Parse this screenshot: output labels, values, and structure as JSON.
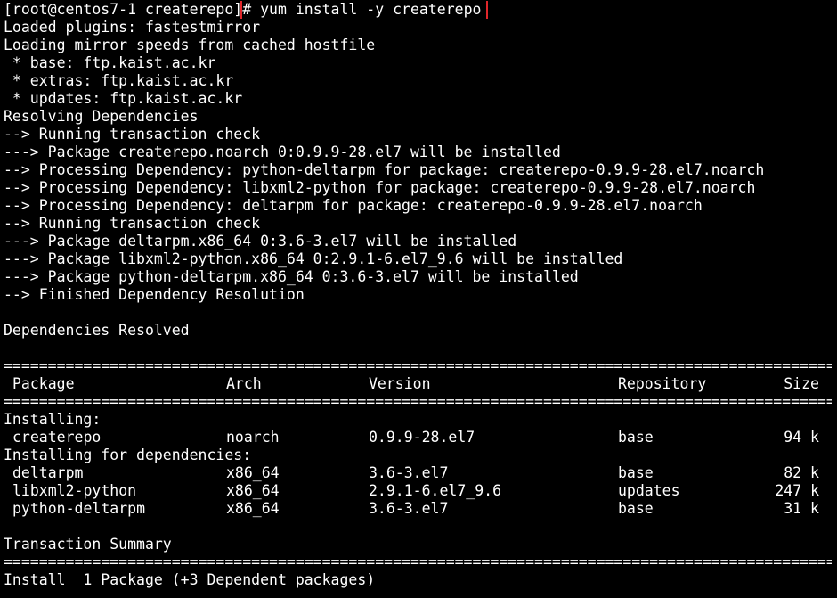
{
  "prompt": "[root@centos7-1 createrepo]",
  "command": "# yum install -y createrepo",
  "pre_lines": [
    "Loaded plugins: fastestmirror",
    "Loading mirror speeds from cached hostfile",
    " * base: ftp.kaist.ac.kr",
    " * extras: ftp.kaist.ac.kr",
    " * updates: ftp.kaist.ac.kr",
    "Resolving Dependencies",
    "--> Running transaction check",
    "---> Package createrepo.noarch 0:0.9.9-28.el7 will be installed",
    "--> Processing Dependency: python-deltarpm for package: createrepo-0.9.9-28.el7.noarch",
    "--> Processing Dependency: libxml2-python for package: createrepo-0.9.9-28.el7.noarch",
    "--> Processing Dependency: deltarpm for package: createrepo-0.9.9-28.el7.noarch",
    "--> Running transaction check",
    "---> Package deltarpm.x86_64 0:3.6-3.el7 will be installed",
    "---> Package libxml2-python.x86_64 0:2.9.1-6.el7_9.6 will be installed",
    "---> Package python-deltarpm.x86_64 0:3.6-3.el7 will be installed",
    "--> Finished Dependency Resolution",
    "",
    "Dependencies Resolved",
    ""
  ],
  "separator": "==========================================================================================================",
  "table": {
    "headers": {
      "package": "Package",
      "arch": "Arch",
      "version": "Version",
      "repository": "Repository",
      "size": "Size"
    },
    "installing_label": "Installing:",
    "installing": [
      {
        "package": "createrepo",
        "arch": "noarch",
        "version": "0.9.9-28.el7",
        "repository": "base",
        "size": "94 k"
      }
    ],
    "deps_label": "Installing for dependencies:",
    "deps": [
      {
        "package": "deltarpm",
        "arch": "x86_64",
        "version": "3.6-3.el7",
        "repository": "base",
        "size": "82 k"
      },
      {
        "package": "libxml2-python",
        "arch": "x86_64",
        "version": "2.9.1-6.el7_9.6",
        "repository": "updates",
        "size": "247 k"
      },
      {
        "package": "python-deltarpm",
        "arch": "x86_64",
        "version": "3.6-3.el7",
        "repository": "base",
        "size": "31 k"
      }
    ]
  },
  "summary_label": "Transaction Summary",
  "install_line": "Install  1 Package (+3 Dependent packages)",
  "colors": {
    "background": "#000000",
    "text": "#ffffff",
    "highlight_box": "#e0262a"
  }
}
